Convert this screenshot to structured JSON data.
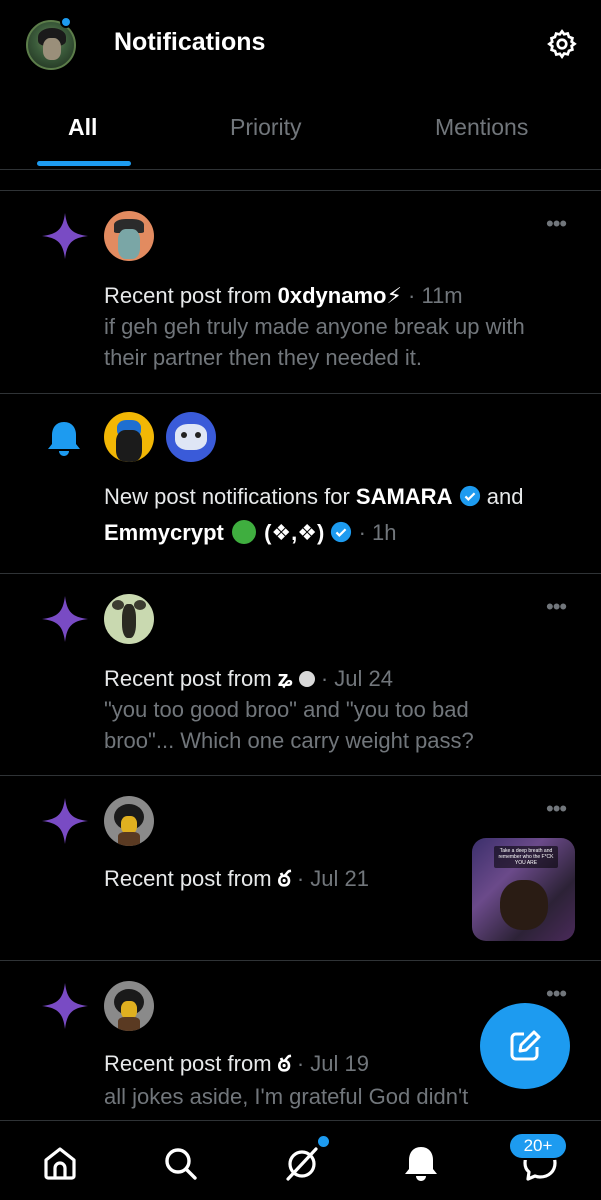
{
  "header": {
    "title": "Notifications"
  },
  "tabs": [
    {
      "label": "All",
      "active": true
    },
    {
      "label": "Priority",
      "active": false
    },
    {
      "label": "Mentions",
      "active": false
    }
  ],
  "notifications": [
    {
      "type": "recent-post",
      "prefix": "Recent post from",
      "user": "0xdynamo⚡",
      "time": "· 11m",
      "body": "if geh geh truly made anyone break up with their partner then they needed it."
    },
    {
      "type": "new-post-notifications",
      "prefix": "New post notifications for",
      "user1": "SAMARA",
      "conj": "and",
      "user2": "Emmycrypt",
      "user2_suffix": "(❖,❖)",
      "time": "· 1h"
    },
    {
      "type": "recent-post",
      "prefix": "Recent post from",
      "user": "ʑ",
      "time": "· Jul 24",
      "body": "\"you too good broo\" and \"you too bad broo\"... Which one carry weight pass?"
    },
    {
      "type": "recent-post",
      "prefix": "Recent post from",
      "user": "ఠ",
      "time": "· Jul 21",
      "thumb_caption": "Take a deep breath and remember who the F*CK YOU ARE"
    },
    {
      "type": "recent-post",
      "prefix": "Recent post from",
      "user": "ఠ",
      "time": "· Jul 19",
      "body": "all jokes aside, I'm grateful God didn't"
    }
  ],
  "bottom_nav": {
    "items": [
      "home-icon",
      "search-icon",
      "grok-icon",
      "notifications-icon",
      "messages-icon"
    ],
    "messages_badge": "20+"
  },
  "colors": {
    "accent": "#1d9bf0",
    "sparkle": "#794bc4",
    "muted": "#71767b",
    "divider": "#2f3336"
  }
}
